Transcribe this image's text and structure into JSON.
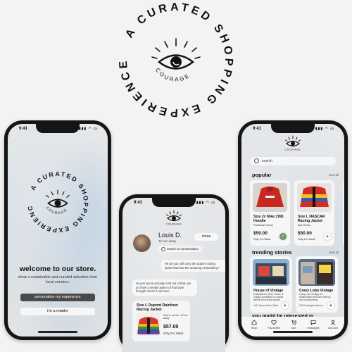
{
  "brand": {
    "name": "COURAGE",
    "tagline": "A CURATED SHOPPING EXPERIENCE"
  },
  "status_bar": {
    "time": "9:41"
  },
  "onboarding": {
    "title": "welcome to our store.",
    "subtitle": "shop a sustainable and curated selection from local vendors.",
    "primary_button": "personalize my experience",
    "secondary_button": "i'm a retailer"
  },
  "chat": {
    "contact_name": "Louis D.",
    "last_seen": "12 sec away",
    "close_label": "close",
    "search_placeholder": "search in conversation",
    "messages": [
      {
        "side": "right",
        "text": "Hi! do you still carry the dupont racing jacket that has the amazing embroidery?"
      },
      {
        "side": "left",
        "text": "Hi yes! we've actually sold out of that, we do have a similar jacket of that style though! check it out here:"
      }
    ],
    "shared_product": {
      "title": "Size L Dupont Rainbow Racing Jacket",
      "meta": "Size in Leeds / 12 hrs away",
      "price": "$57.00",
      "stock": "Only 2 In Stock"
    }
  },
  "shop": {
    "search_placeholder": "search",
    "popular": {
      "title": "popular",
      "see_all": "See all",
      "items": [
        {
          "title": "Size 2x Nike 1991 Hoodie",
          "meta": "Flashback Factory",
          "price": "$50.00",
          "stock": "Only 1 In Stock",
          "added": true
        },
        {
          "title": "Size L NASCAR Racing Jacket",
          "meta": "Blue Dream",
          "price": "$50.00",
          "stock": "Only 1 In Stock",
          "added": false
        }
      ]
    },
    "trending": {
      "title": "trending stories",
      "see_all": "See all",
      "items": [
        {
          "title": "House of Vintage",
          "desc": "Established in 2012, House of Vintage specializes in curated fashion from every decade.",
          "meta": "1451 Queen Street West"
        },
        {
          "title": "Crazy Lobo Vintage",
          "desc": "Crazy Lobo Vintage is a collaborative thrift store offering one-of-a-kind finds.",
          "meta": "243 Kensington Avenue"
        }
      ]
    },
    "may_like_title": "you might be interested in",
    "tabs": [
      "Shop",
      "Favourites",
      "Cart",
      "messages",
      "Account"
    ]
  },
  "icons": {
    "eye": "eye-icon",
    "search": "search-icon",
    "plus": "plus-icon",
    "check": "check-icon",
    "shop": "shop-icon",
    "heart": "heart-icon",
    "cart": "cart-icon",
    "message": "message-icon",
    "account": "account-icon"
  },
  "colors": {
    "background": "#f3f3f3",
    "phone_frame": "#151515",
    "button_dark": "#4a4a4a",
    "added_green": "#6b9a62"
  }
}
